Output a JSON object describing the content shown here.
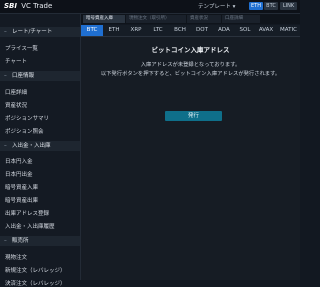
{
  "app": {
    "logo_mark": "SBI",
    "logo_text": "VC Trade",
    "template_label": "テンプレート ▾",
    "chips": [
      "ETH",
      "BTC",
      "LINK"
    ]
  },
  "sidebar": {
    "groups": [
      {
        "header": "レート/チャート",
        "items": [
          "プライス一覧",
          "チャート"
        ]
      },
      {
        "header": "口座情報",
        "items": [
          "口座詳細",
          "資産状況",
          "ポジションサマリ",
          "ポジション照会"
        ]
      },
      {
        "header": "入出金・入出庫",
        "items": [
          "日本円入金",
          "日本円出金",
          "暗号資産入庫",
          "暗号資産出庫",
          "出庫アドレス登録",
          "入出金・入出庫履歴"
        ]
      },
      {
        "header": "販売所",
        "items": [
          "現物注文",
          "新規注文（レバレッジ）",
          "決済注文（レバレッジ）"
        ]
      }
    ]
  },
  "tabs": [
    {
      "label": "暗号資産入庫",
      "active": true
    },
    {
      "label": "現物注文（取引所）",
      "active": false
    },
    {
      "label": "資産状況",
      "active": false
    },
    {
      "label": "口座詳細",
      "active": false
    }
  ],
  "coins": [
    "BTC",
    "ETH",
    "XRP",
    "LTC",
    "BCH",
    "DOT",
    "ADA",
    "SOL",
    "AVAX",
    "MATIC"
  ],
  "selected_coin": "BTC",
  "main": {
    "title": "ビットコイン入庫アドレス",
    "message_line1": "入庫アドレスが未登録となっております。",
    "message_line2": "以下発行ボタンを押下すると、ビットコイン入庫アドレスが発行されます。",
    "issue_button": "発行"
  }
}
